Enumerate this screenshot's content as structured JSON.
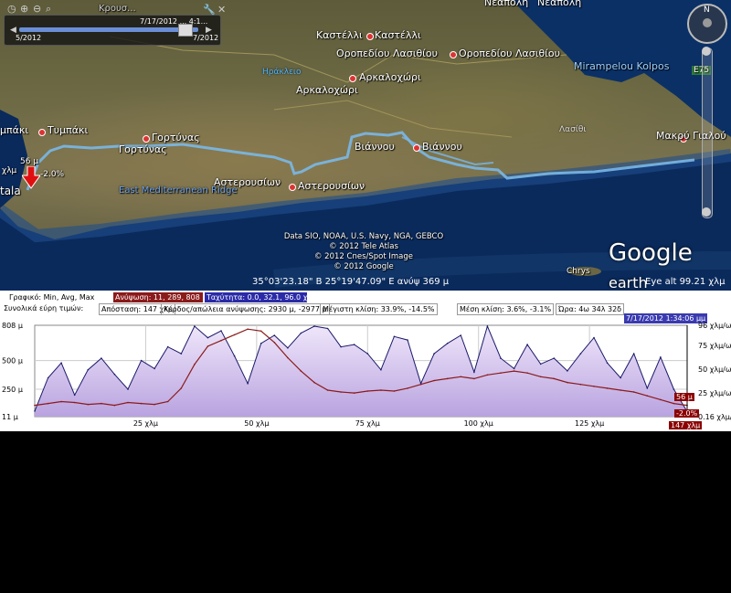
{
  "colors": {
    "sea": "#0a2a5c",
    "route": "#7ab8e8",
    "elev_fill": "#d8c7ee",
    "elev_line": "#1a1a6a",
    "speed_line": "#8b1a1a",
    "elev_badge": "#8b0000",
    "speed_badge": "#2b2b9b"
  },
  "map": {
    "slider": {
      "date_top": "7/17/2012 ... 4:1...",
      "start": "5/2012",
      "end": "7/2012",
      "partial_top": "Κρουσ..."
    },
    "places": [
      {
        "name": "Νεάπολη",
        "x": null
      },
      {
        "name": "Καστέλλι"
      },
      {
        "name": "Οροπεδίου Λασιθίου"
      },
      {
        "name": "Αρκαλοχώρι"
      },
      {
        "name": "Τυμπάκι"
      },
      {
        "name": "Γορτύνας"
      },
      {
        "name": "Βιάννου"
      },
      {
        "name": "Αστερουσίων"
      },
      {
        "name": "Μακρύ Γιαλού"
      }
    ],
    "labels": {
      "neapoli1": "Νεάπολη",
      "neapoli2": "Νεάπολη",
      "kastelli1": "Καστέλλι",
      "kastelli2": "Καστέλλι",
      "oropedio1": "Οροπεδίου Λασιθίου",
      "oropedio2": "Οροπεδίου Λασιθίου",
      "arkalo1": "Αρκαλοχώρι",
      "arkalo2": "Αρκαλοχώρι",
      "irakleio": "Ηράκλειο",
      "tympaki1": "μπάκι",
      "tympaki2": "Τυμπάκι",
      "gortynas1": "Γορτύνας",
      "gortynas2": "Γορτύνας",
      "viannou1": "Βιάννου",
      "viannou2": "Βιάννου",
      "asterousion1": "Αστερουσίων",
      "asterousion2": "Αστερουσίων",
      "makry": "Μακρύ Γιαλού",
      "mirampelou": "Mirampelou Kolpos",
      "lasithi": "Λασίθι",
      "e75": "E75",
      "ridge": "East Mediterranean Ridge",
      "chrysi": "Chrys",
      "tala": "tala",
      "marker_elev": "56 μ",
      "marker_grade": "-2.0%",
      "marker_left": "χλμ"
    },
    "attribution": [
      "Data SIO, NOAA, U.S. Navy, NGA, GEBCO",
      "© 2012 Tele Atlas",
      "© 2012 Cnes/Spot Image",
      "© 2012 Google"
    ],
    "logo": {
      "main": "Google",
      "sub": "earth"
    },
    "status": {
      "coords": "35°03'23.18\" B  25°19'47.09\" E  ανύψ  369 μ",
      "eye_alt": "Eye alt  99.21 χλμ"
    }
  },
  "profile": {
    "row1": {
      "graph_label": "Γραφικό: Min, Avg, Max",
      "elevation": "Ανύψωση: 11, 289, 808 μ",
      "speed": "Ταχύτητα: 0.0, 32.1, 96.0 χλμ/ω"
    },
    "row2": {
      "summary_label": "Συνολικά εύρη τιμών:",
      "distance": "Απόσταση: 147 χλμ",
      "gain": "Κέρδος/απώλεια ανύψωσης: 2930 μ, -2977 μ",
      "max_slope": "Μέγιστη κλίση: 33.9%, -14.5%",
      "avg_slope": "Μέση κλίση: 3.6%, -3.1%",
      "time": "Ώρα: 4ω 34λ 32δ"
    },
    "timestamp": "7/17/2012 1:34:06 μμ",
    "y_left_ticks": [
      "808 μ",
      "500 μ",
      "250 μ",
      "11 μ"
    ],
    "y_right_ticks": [
      "96 χλμ/ω",
      "75 χλμ/ω",
      "50 χλμ/ω",
      "25 χλμ/ω",
      "0.16 χλμ/ω"
    ],
    "x_ticks": [
      "25 χλμ",
      "50 χλμ",
      "75 χλμ",
      "100 χλμ",
      "125 χλμ"
    ],
    "cursor_badges": {
      "elev": "56 μ",
      "grade": "-2.0%",
      "dist": "147 χλμ"
    },
    "close": "x"
  },
  "chart_data": {
    "type": "area",
    "x_unit": "km",
    "x": [
      0,
      3,
      6,
      9,
      12,
      15,
      18,
      21,
      24,
      27,
      30,
      33,
      36,
      39,
      42,
      45,
      48,
      51,
      54,
      57,
      60,
      63,
      66,
      69,
      72,
      75,
      78,
      81,
      84,
      87,
      90,
      93,
      96,
      99,
      102,
      105,
      108,
      111,
      114,
      117,
      120,
      123,
      126,
      129,
      132,
      135,
      138,
      141,
      144,
      147
    ],
    "series": [
      {
        "name": "Ανύψωση",
        "unit": "μ",
        "values": [
          60,
          350,
          480,
          200,
          420,
          520,
          380,
          250,
          500,
          430,
          620,
          560,
          800,
          700,
          760,
          540,
          300,
          650,
          720,
          610,
          740,
          800,
          780,
          620,
          640,
          560,
          420,
          710,
          680,
          300,
          560,
          650,
          720,
          400,
          800,
          520,
          430,
          640,
          470,
          520,
          410,
          560,
          700,
          480,
          350,
          560,
          260,
          530,
          250,
          56
        ]
      },
      {
        "name": "Ταχύτητα",
        "unit": "χλμ/ω",
        "values": [
          12,
          14,
          16,
          15,
          13,
          14,
          12,
          15,
          14,
          13,
          16,
          30,
          55,
          74,
          80,
          86,
          92,
          90,
          78,
          62,
          48,
          36,
          28,
          26,
          25,
          27,
          28,
          27,
          30,
          34,
          38,
          40,
          42,
          40,
          44,
          46,
          48,
          46,
          42,
          40,
          36,
          34,
          32,
          30,
          28,
          26,
          22,
          18,
          14,
          12
        ]
      }
    ],
    "ylim_left": [
      11,
      808
    ],
    "ylim_right": [
      0.16,
      96
    ],
    "xlim": [
      0,
      147
    ],
    "grid": true
  }
}
